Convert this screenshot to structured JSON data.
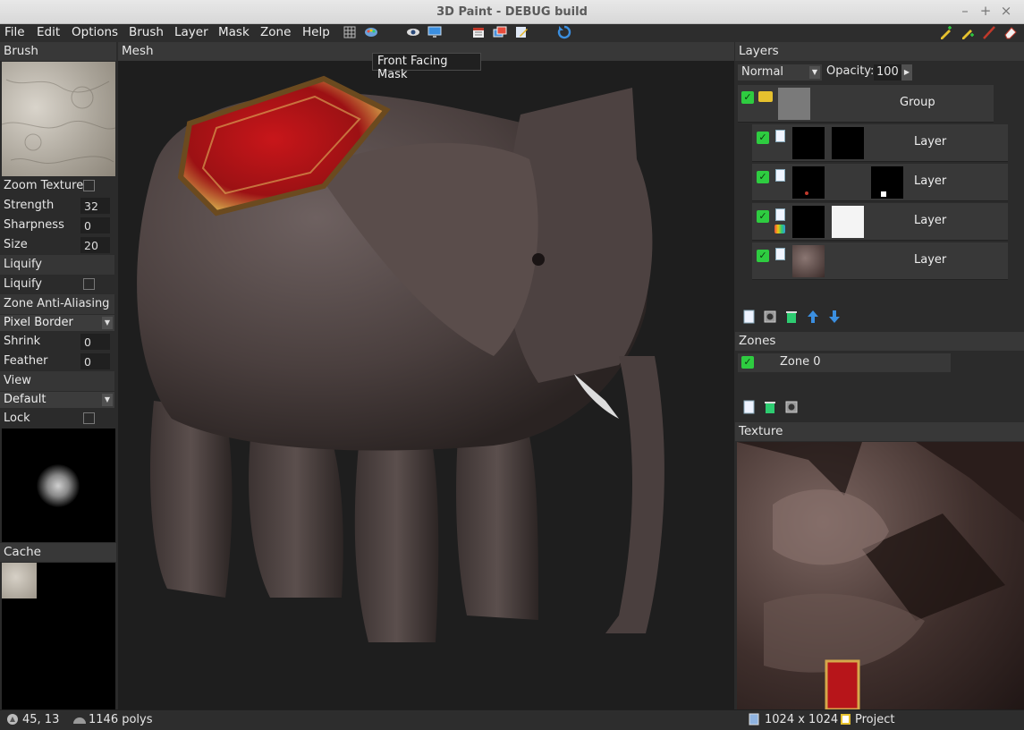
{
  "window": {
    "title": "3D Paint - DEBUG build",
    "controls": [
      "–",
      "+",
      "×"
    ]
  },
  "menu": {
    "items": [
      "File",
      "Edit",
      "Options",
      "Brush",
      "Layer",
      "Mask",
      "Zone",
      "Help"
    ]
  },
  "toolbar": {
    "tooltip": "Front Facing Mask",
    "icons": [
      "grid-icon",
      "palette-icon",
      "eye-icon",
      "monitor-icon",
      "calendar-icon",
      "windows-icon",
      "edit-icon",
      "refresh-icon",
      "pencil-add-icon",
      "pencil-icon",
      "red-brush-icon",
      "eraser-icon"
    ]
  },
  "left": {
    "brush_header": "Brush",
    "zoom_texture": "Zoom Texture",
    "strength": {
      "label": "Strength",
      "value": "32"
    },
    "sharpness": {
      "label": "Sharpness",
      "value": "0"
    },
    "size": {
      "label": "Size",
      "value": "20"
    },
    "liquify_header": "Liquify",
    "liquify_label": "Liquify",
    "zone_aa_header": "Zone Anti-Aliasing",
    "pixel_border": "Pixel Border",
    "shrink": {
      "label": "Shrink",
      "value": "0"
    },
    "feather": {
      "label": "Feather",
      "value": "0"
    },
    "view_header": "View",
    "view_mode": "Default",
    "lock": "Lock",
    "cache_header": "Cache"
  },
  "center": {
    "header": "Mesh"
  },
  "right": {
    "layers_header": "Layers",
    "blend_mode": "Normal",
    "opacity_label": "Opacity:",
    "opacity_value": "100",
    "group_label": "Group",
    "layers": [
      "Layer",
      "Layer",
      "Layer",
      "Layer"
    ],
    "zones_header": "Zones",
    "zone_label": "Zone 0",
    "texture_header": "Texture"
  },
  "status": {
    "coords": "45, 13",
    "polys": "1146 polys",
    "texture_size": "1024 x 1024",
    "project": "Project"
  }
}
